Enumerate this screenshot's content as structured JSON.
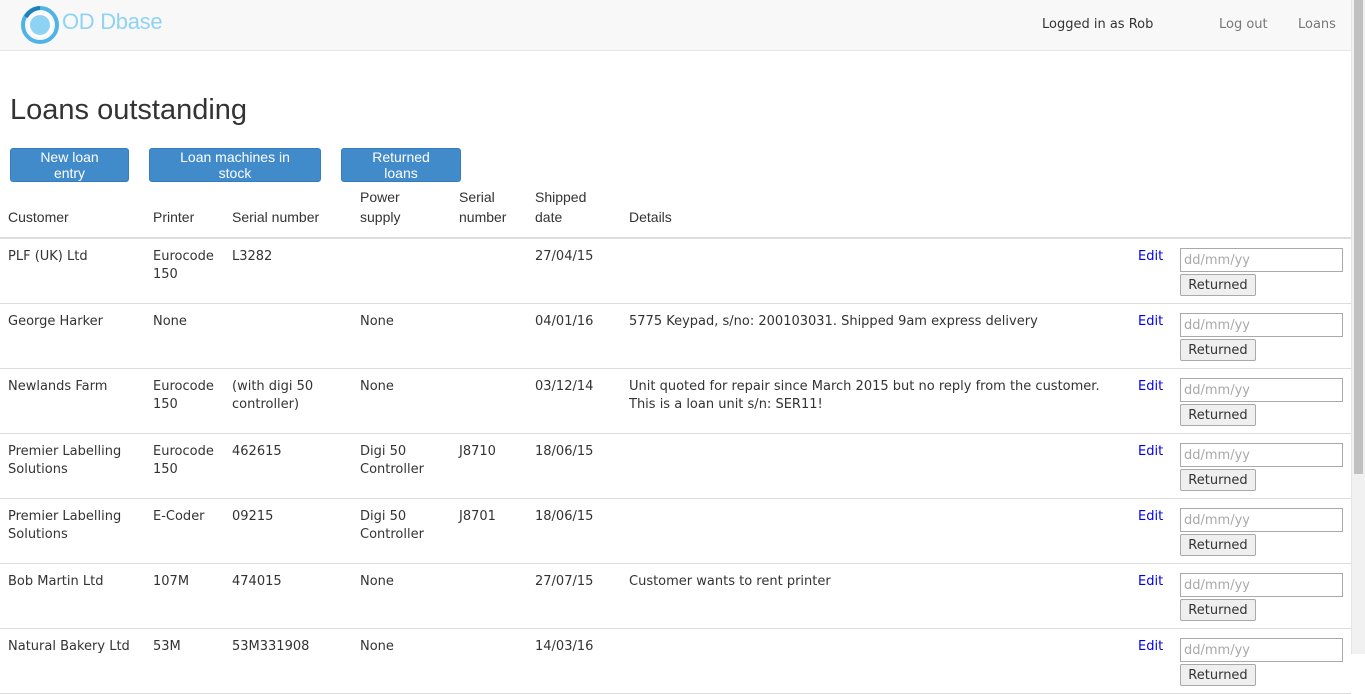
{
  "brand": {
    "name": "OD Dbase",
    "accent": "#4fb3e6"
  },
  "nav": {
    "user_text": "Logged in as Rob",
    "logout": "Log out",
    "loans": "Loans"
  },
  "page": {
    "title": "Loans outstanding"
  },
  "actions": {
    "new_loan": "New loan entry",
    "machines": "Loan machines in stock",
    "returned": "Returned loans"
  },
  "table": {
    "headers": {
      "customer": "Customer",
      "printer": "Printer",
      "serial": "Serial number",
      "power_1": "Power",
      "power_2": "supply",
      "serial2_1": "Serial",
      "serial2_2": "number",
      "shipped_1": "Shipped",
      "shipped_2": "date",
      "details": "Details"
    },
    "edit_label": "Edit",
    "date_placeholder": "dd/mm/yy",
    "returned_label": "Returned",
    "rows": [
      {
        "customer": "PLF (UK) Ltd",
        "printer": "Eurocode 150",
        "serial": "L3282",
        "power": "",
        "serial2": "",
        "shipped": "27/04/15",
        "details": ""
      },
      {
        "customer": "George Harker",
        "printer": "None",
        "serial": "",
        "power": "None",
        "serial2": "",
        "shipped": "04/01/16",
        "details": "5775 Keypad, s/no: 200103031. Shipped 9am express delivery"
      },
      {
        "customer": "Newlands Farm",
        "printer": "Eurocode 150",
        "serial": "(with digi 50 controller)",
        "power": "None",
        "serial2": "",
        "shipped": "03/12/14",
        "details": "Unit quoted for repair since March 2015 but no reply from the customer. This is a loan unit s/n: SER11!"
      },
      {
        "customer": "Premier Labelling Solutions",
        "printer": "Eurocode 150",
        "serial": "462615",
        "power": "Digi 50 Controller",
        "serial2": "J8710",
        "shipped": "18/06/15",
        "details": ""
      },
      {
        "customer": "Premier Labelling Solutions",
        "printer": "E-Coder",
        "serial": "09215",
        "power": "Digi 50 Controller",
        "serial2": "J8701",
        "shipped": "18/06/15",
        "details": ""
      },
      {
        "customer": "Bob Martin Ltd",
        "printer": "107M",
        "serial": "474015",
        "power": "None",
        "serial2": "",
        "shipped": "27/07/15",
        "details": "Customer wants to rent printer"
      },
      {
        "customer": "Natural Bakery Ltd",
        "printer": "53M",
        "serial": "53M331908",
        "power": "None",
        "serial2": "",
        "shipped": "14/03/16",
        "details": ""
      }
    ]
  }
}
